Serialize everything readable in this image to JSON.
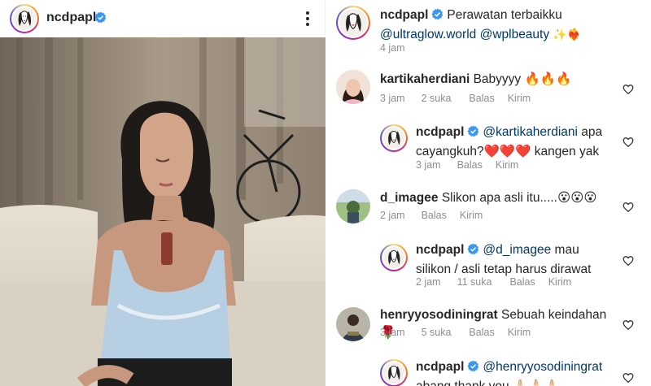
{
  "post": {
    "username": "ncdpapl",
    "more_icon": "more-vertical-icon"
  },
  "caption": {
    "username": "ncdpapl",
    "text": "Perawatan terbaikku",
    "mention1": "@ultraglow.world",
    "mention2": "@wplbeauty",
    "emoji": "✨❤️‍🔥",
    "time": "4 jam"
  },
  "comments": [
    {
      "username": "kartikaherdiani",
      "text": "Babyyyy 🔥🔥🔥",
      "time": "3 jam",
      "likes": "2 suka",
      "reply": "Balas",
      "send": "Kirim"
    },
    {
      "username": "ncdpapl",
      "mention": "@kartikaherdiani",
      "text1": "apa",
      "text2": "cayangkuh?❤️❤️❤️ kangen yak",
      "time": "3 jam",
      "reply": "Balas",
      "send": "Kirim"
    },
    {
      "username": "d_imagee",
      "text": "Slikon apa asli itu.....😮😮😮",
      "time": "2 jam",
      "reply": "Balas",
      "send": "Kirim"
    },
    {
      "username": "ncdpapl",
      "mention": "@d_imagee",
      "text1": "mau",
      "text2": "silikon / asli tetap harus dirawat",
      "time": "2 jam",
      "likes": "11 suka",
      "reply": "Balas",
      "send": "Kirim"
    },
    {
      "username": "henryyosodiningrat",
      "text": "Sebuah keindahan 🌹",
      "time": "3 jam",
      "likes": "5 suka",
      "reply": "Balas",
      "send": "Kirim"
    },
    {
      "username": "ncdpapl",
      "mention": "@henryyosodiningrat",
      "text2": "abang thank you 🙏🏻🙏🏻🙏🏻"
    }
  ],
  "colors": {
    "verified": "#3897f0",
    "mention": "#00376b",
    "meta": "#8e8e8e"
  }
}
